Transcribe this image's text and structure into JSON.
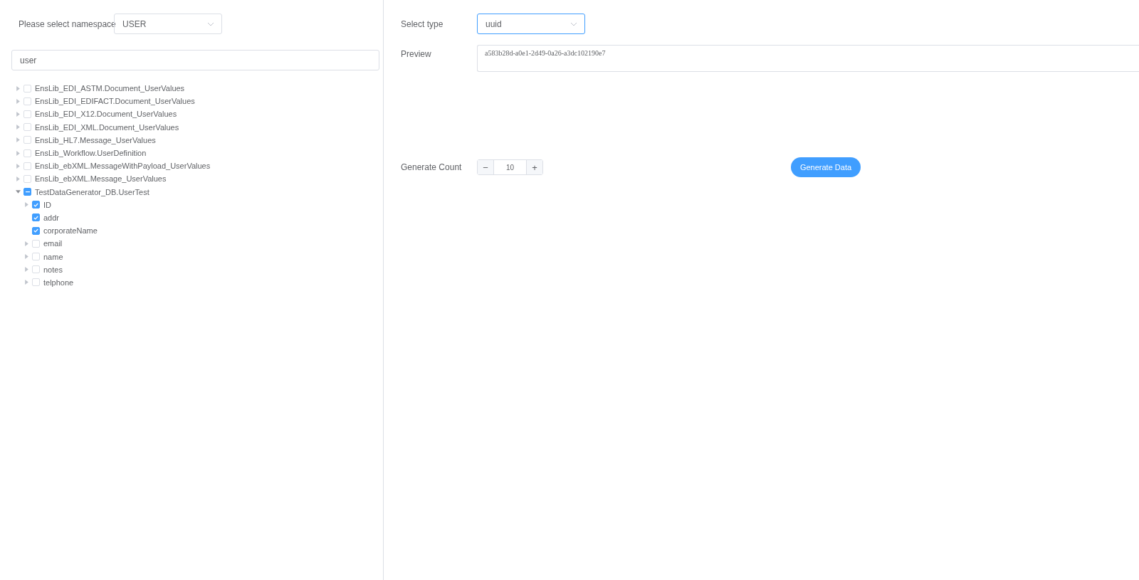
{
  "namespace": {
    "label": "Please select namespace",
    "value": "USER"
  },
  "search": {
    "value": "user"
  },
  "tree": [
    {
      "label": "EnsLib_EDI_ASTM.Document_UserValues",
      "checked": false,
      "indeterminate": false,
      "expandable": true,
      "expanded": false
    },
    {
      "label": "EnsLib_EDI_EDIFACT.Document_UserValues",
      "checked": false,
      "indeterminate": false,
      "expandable": true,
      "expanded": false
    },
    {
      "label": "EnsLib_EDI_X12.Document_UserValues",
      "checked": false,
      "indeterminate": false,
      "expandable": true,
      "expanded": false
    },
    {
      "label": "EnsLib_EDI_XML.Document_UserValues",
      "checked": false,
      "indeterminate": false,
      "expandable": true,
      "expanded": false
    },
    {
      "label": "EnsLib_HL7.Message_UserValues",
      "checked": false,
      "indeterminate": false,
      "expandable": true,
      "expanded": false
    },
    {
      "label": "EnsLib_Workflow.UserDefinition",
      "checked": false,
      "indeterminate": false,
      "expandable": true,
      "expanded": false
    },
    {
      "label": "EnsLib_ebXML.MessageWithPayload_UserValues",
      "checked": false,
      "indeterminate": false,
      "expandable": true,
      "expanded": false
    },
    {
      "label": "EnsLib_ebXML.Message_UserValues",
      "checked": false,
      "indeterminate": false,
      "expandable": true,
      "expanded": false
    },
    {
      "label": "TestDataGenerator_DB.UserTest",
      "checked": false,
      "indeterminate": true,
      "expandable": true,
      "expanded": true,
      "children": [
        {
          "label": "ID",
          "checked": true,
          "indeterminate": false,
          "expandable": true,
          "expanded": false
        },
        {
          "label": "addr",
          "checked": true,
          "indeterminate": false,
          "expandable": false
        },
        {
          "label": "corporateName",
          "checked": true,
          "indeterminate": false,
          "expandable": false
        },
        {
          "label": "email",
          "checked": false,
          "indeterminate": false,
          "expandable": true,
          "expanded": false
        },
        {
          "label": "name",
          "checked": false,
          "indeterminate": false,
          "expandable": true,
          "expanded": false
        },
        {
          "label": "notes",
          "checked": false,
          "indeterminate": false,
          "expandable": true,
          "expanded": false
        },
        {
          "label": "telphone",
          "checked": false,
          "indeterminate": false,
          "expandable": true,
          "expanded": false
        }
      ]
    }
  ],
  "type_select": {
    "label": "Select type",
    "value": "uuid",
    "focused": true
  },
  "preview": {
    "label": "Preview",
    "value": "a583b28d-a0e1-2d49-0a26-a3dc102190e7"
  },
  "generate_count": {
    "label": "Generate Count",
    "minus": "−",
    "value": "10",
    "plus": "+"
  },
  "generate_button": "Generate Data"
}
